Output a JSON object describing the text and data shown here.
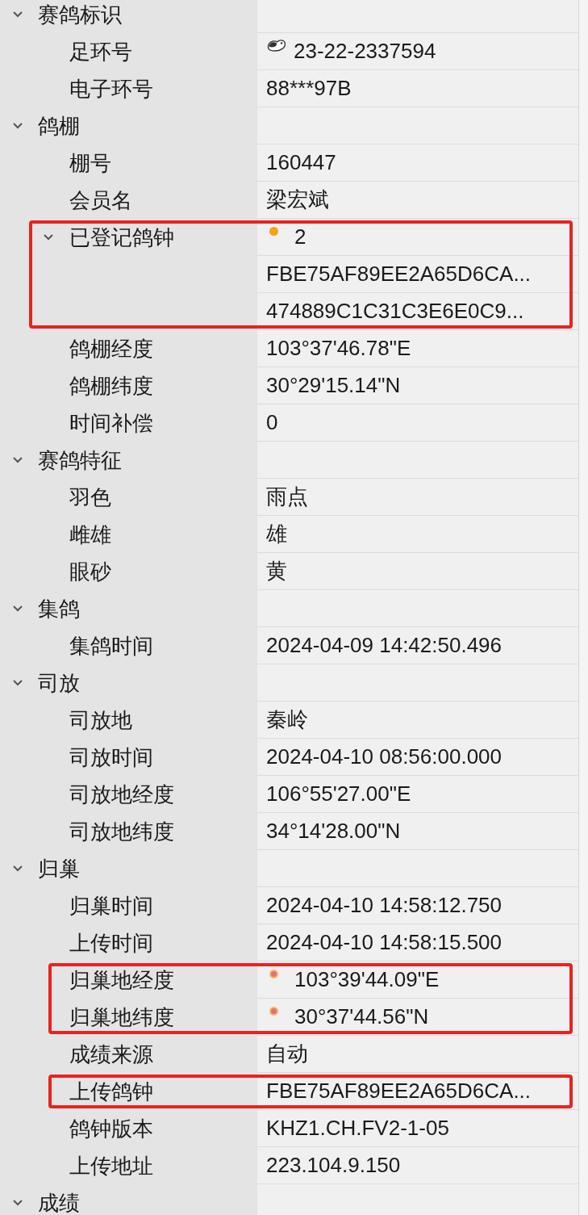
{
  "groups": [
    {
      "label": "赛鸽标识",
      "expanded": true,
      "items": [
        {
          "label": "足环号",
          "value": "23-22-2337594",
          "kind": "bird",
          "highlighted": false
        },
        {
          "label": "电子环号",
          "value": "88***97B",
          "highlighted": false
        }
      ]
    },
    {
      "label": "鸽棚",
      "expanded": true,
      "items": [
        {
          "label": "棚号",
          "value": "160447",
          "highlighted": false
        },
        {
          "label": "会员名",
          "value": "梁宏斌",
          "highlighted": false
        },
        {
          "label": "已登记鸽钟",
          "value": "2",
          "kind": "dot",
          "expanded": true,
          "highlighted": true,
          "children": [
            {
              "value": "FBE75AF89EE2A65D6CA...",
              "highlighted": true
            },
            {
              "value": "474889C1C31C3E6E0C9...",
              "highlighted": true
            }
          ]
        },
        {
          "label": "鸽棚经度",
          "value": "103°37'46.78\"E",
          "highlighted": false
        },
        {
          "label": "鸽棚纬度",
          "value": "30°29'15.14\"N",
          "highlighted": false
        },
        {
          "label": "时间补偿",
          "value": "0",
          "highlighted": false
        }
      ]
    },
    {
      "label": "赛鸽特征",
      "expanded": true,
      "items": [
        {
          "label": "羽色",
          "value": "雨点",
          "highlighted": false
        },
        {
          "label": "雌雄",
          "value": "雄",
          "highlighted": false
        },
        {
          "label": "眼砂",
          "value": "黄",
          "highlighted": false
        }
      ]
    },
    {
      "label": "集鸽",
      "expanded": true,
      "items": [
        {
          "label": "集鸽时间",
          "value": "2024-04-09 14:42:50.496",
          "highlighted": false
        }
      ]
    },
    {
      "label": "司放",
      "expanded": true,
      "items": [
        {
          "label": "司放地",
          "value": "秦岭",
          "highlighted": false
        },
        {
          "label": "司放时间",
          "value": "2024-04-10 08:56:00.000",
          "highlighted": false
        },
        {
          "label": "司放地经度",
          "value": "106°55'27.00\"E",
          "highlighted": false
        },
        {
          "label": "司放地纬度",
          "value": "34°14'28.00\"N",
          "highlighted": false
        }
      ]
    },
    {
      "label": "归巢",
      "expanded": true,
      "items": [
        {
          "label": "归巢时间",
          "value": "2024-04-10 14:58:12.750",
          "highlighted": false
        },
        {
          "label": "上传时间",
          "value": "2024-04-10 14:58:15.500",
          "highlighted": false
        },
        {
          "label": "归巢地经度",
          "value": "103°39'44.09\"E",
          "kind": "pin",
          "highlighted": true
        },
        {
          "label": "归巢地纬度",
          "value": "30°37'44.56\"N",
          "kind": "pin",
          "highlighted": true
        },
        {
          "label": "成绩来源",
          "value": "自动",
          "highlighted": false
        },
        {
          "label": "上传鸽钟",
          "value": "FBE75AF89EE2A65D6CA...",
          "highlighted": true
        },
        {
          "label": "鸽钟版本",
          "value": "KHZ1.CH.FV2-1-05",
          "highlighted": false
        },
        {
          "label": "上传地址",
          "value": "223.104.9.150",
          "highlighted": false
        }
      ]
    },
    {
      "label": "成绩",
      "expanded": true
    }
  ]
}
